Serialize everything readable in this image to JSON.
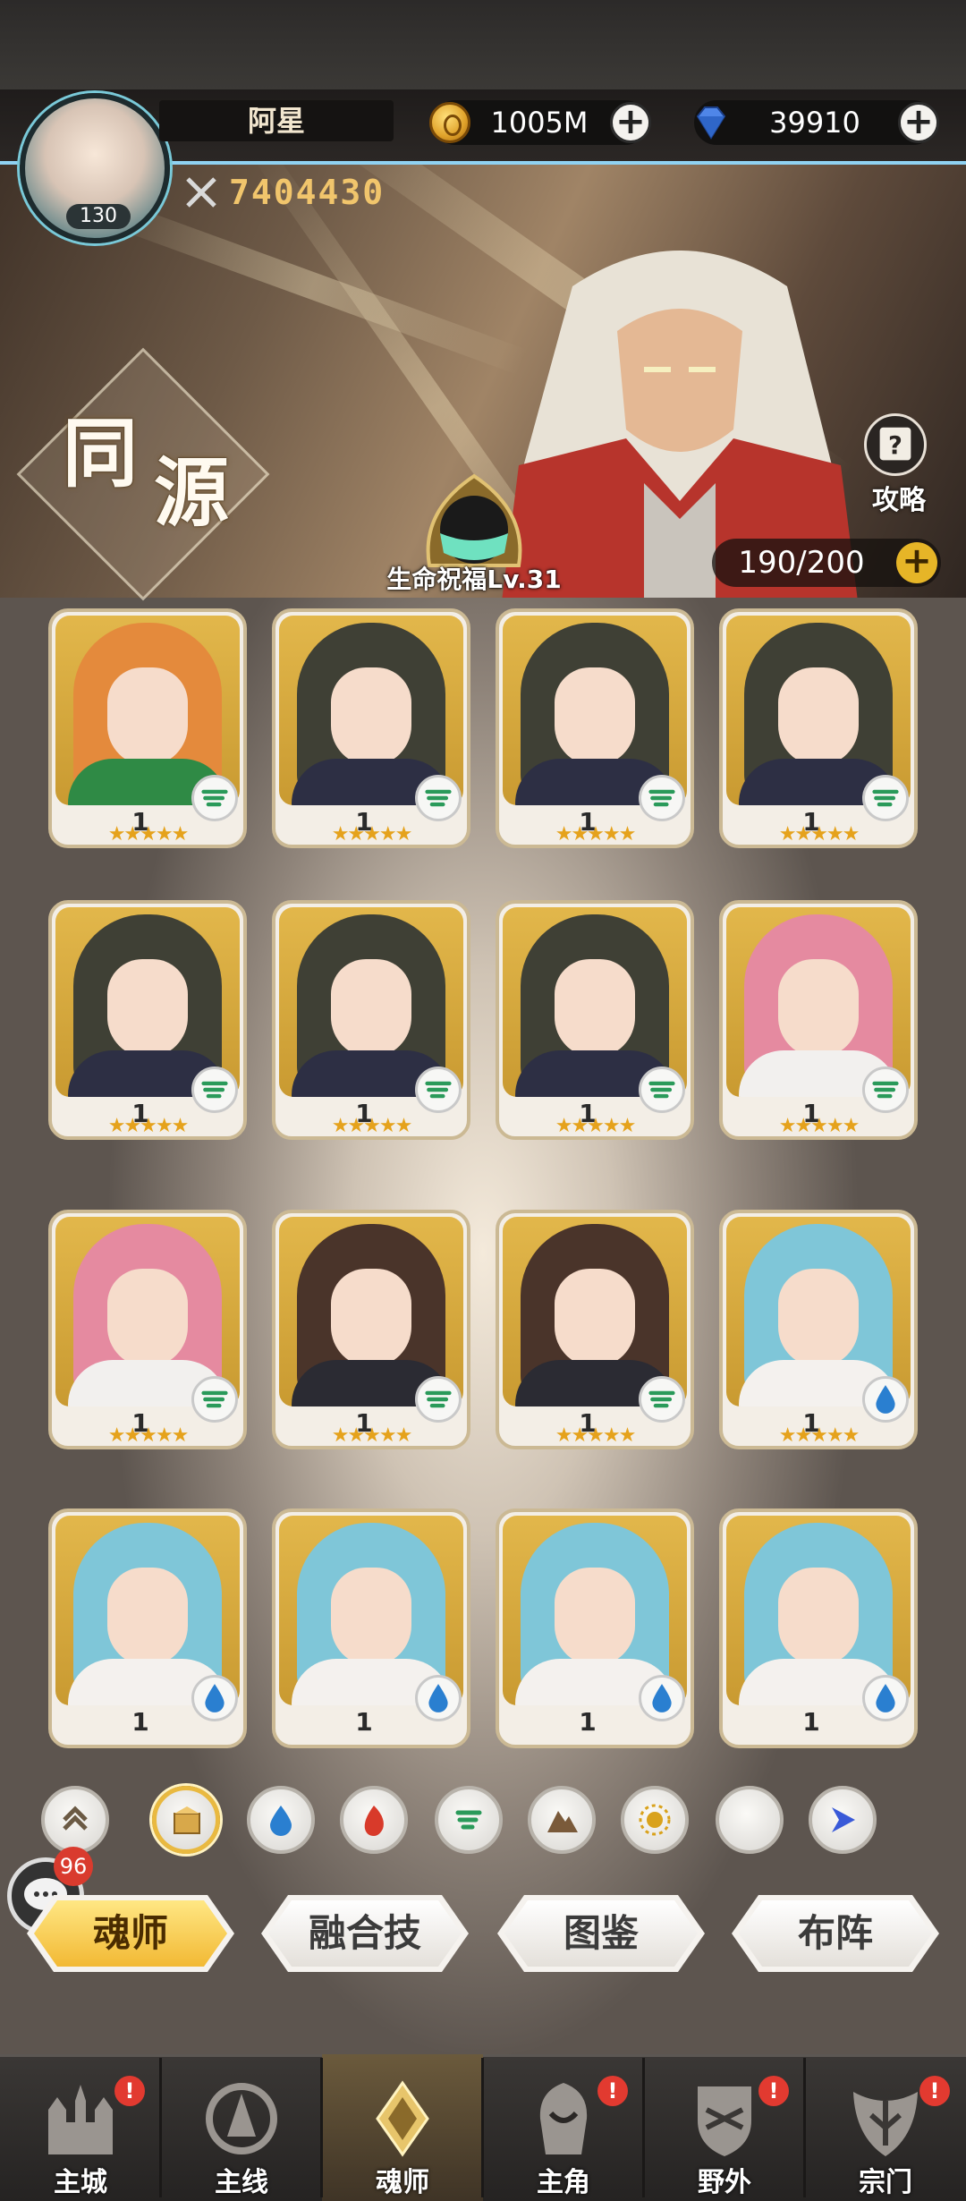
{
  "header": {
    "player_name": "阿星",
    "avatar_level": "130",
    "gold": "1005M",
    "diamonds": "39910",
    "power": "7404430"
  },
  "banner": {
    "title_char1": "同",
    "title_char2": "源",
    "guide_label": "攻略",
    "blessing_label": "生命祝福Lv.31",
    "capacity": "190/200"
  },
  "cards": [
    {
      "level": "1",
      "element": "wind",
      "hair": "#e48a3c",
      "body": "#2f8a45",
      "stars": "★★★★★"
    },
    {
      "level": "1",
      "element": "wind",
      "hair": "#3f4035",
      "body": "#2d2f44",
      "stars": "★★★★★"
    },
    {
      "level": "1",
      "element": "wind",
      "hair": "#3f4035",
      "body": "#2d2f44",
      "stars": "★★★★★"
    },
    {
      "level": "1",
      "element": "wind",
      "hair": "#3f4035",
      "body": "#2d2f44",
      "stars": "★★★★★"
    },
    {
      "level": "1",
      "element": "wind",
      "hair": "#3f4035",
      "body": "#2d2f44",
      "stars": "★★★★★"
    },
    {
      "level": "1",
      "element": "wind",
      "hair": "#3f4035",
      "body": "#2d2f44",
      "stars": "★★★★★"
    },
    {
      "level": "1",
      "element": "wind",
      "hair": "#3f4035",
      "body": "#2d2f44",
      "stars": "★★★★★"
    },
    {
      "level": "1",
      "element": "wind",
      "hair": "#e58aa0",
      "body": "#f2f0ee",
      "stars": "★★★★★"
    },
    {
      "level": "1",
      "element": "wind",
      "hair": "#e58aa0",
      "body": "#f2f0ee",
      "stars": "★★★★★"
    },
    {
      "level": "1",
      "element": "wind",
      "hair": "#4a342a",
      "body": "#2b2b33",
      "stars": "★★★★★"
    },
    {
      "level": "1",
      "element": "wind",
      "hair": "#4a342a",
      "body": "#2b2b33",
      "stars": "★★★★★"
    },
    {
      "level": "1",
      "element": "water",
      "hair": "#7fc6d8",
      "body": "#f4f1ee",
      "stars": "★★★★★"
    },
    {
      "level": "1",
      "element": "water",
      "hair": "#7fc6d8",
      "body": "#f4f1ee",
      "stars": ""
    },
    {
      "level": "1",
      "element": "water",
      "hair": "#7fc6d8",
      "body": "#f4f1ee",
      "stars": ""
    },
    {
      "level": "1",
      "element": "water",
      "hair": "#7fc6d8",
      "body": "#f4f1ee",
      "stars": ""
    },
    {
      "level": "1",
      "element": "water",
      "hair": "#7fc6d8",
      "body": "#f4f1ee",
      "stars": ""
    }
  ],
  "filters": [
    {
      "name": "sort-rank-icon",
      "color": "#6b5a44"
    },
    {
      "name": "all-box-icon",
      "color": "#c99a3a"
    },
    {
      "name": "water-icon",
      "color": "#2a7fd0"
    },
    {
      "name": "fire-icon",
      "color": "#d83a2a"
    },
    {
      "name": "wind-icon",
      "color": "#2a9a5a"
    },
    {
      "name": "earth-icon",
      "color": "#7a5a3a"
    },
    {
      "name": "light-icon",
      "color": "#d9a21c"
    },
    {
      "name": "dark-icon",
      "color": "#6a4ac0"
    },
    {
      "name": "void-icon",
      "color": "#3a5ad8"
    }
  ],
  "chat": {
    "badge": "96"
  },
  "tabs": [
    "魂师",
    "融合技",
    "图鉴",
    "布阵"
  ],
  "nav": [
    {
      "label": "主城",
      "badge": "!",
      "icon": "castle-icon"
    },
    {
      "label": "主线",
      "badge": "",
      "icon": "mainline-icon"
    },
    {
      "label": "魂师",
      "badge": "",
      "icon": "soul-master-icon"
    },
    {
      "label": "主角",
      "badge": "!",
      "icon": "hero-icon"
    },
    {
      "label": "野外",
      "badge": "!",
      "icon": "field-icon"
    },
    {
      "label": "宗门",
      "badge": "!",
      "icon": "sect-icon"
    }
  ]
}
